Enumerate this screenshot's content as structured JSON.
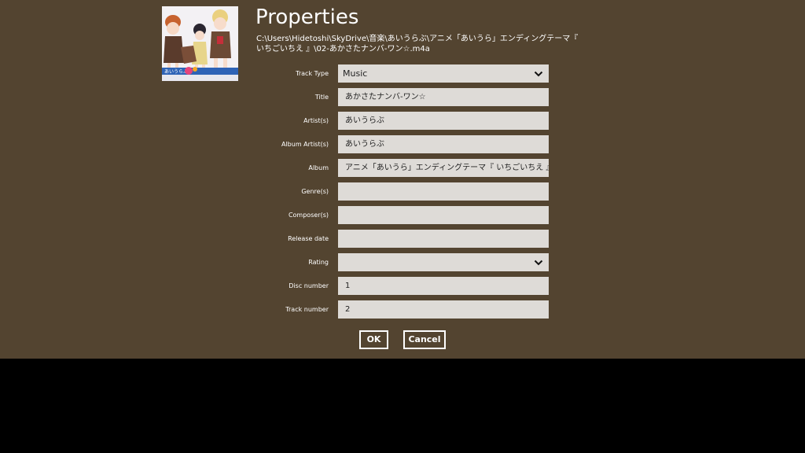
{
  "dialog": {
    "title": "Properties",
    "file_path": "C:\\Users\\Hidetoshi\\SkyDrive\\音楽\\あいうらぶ\\アニメ「あいうら」エンディングテーマ『 いちごいちえ 』\\02-あかさたナンバ-ワン☆.m4a",
    "cover_art_icon": "album-cover-image"
  },
  "fields": {
    "track_type": {
      "label": "Track Type",
      "value": "Music"
    },
    "title": {
      "label": "Title",
      "value": "あかさたナンバ-ワン☆"
    },
    "artists": {
      "label": "Artist(s)",
      "value": "あいうらぶ"
    },
    "album_artists": {
      "label": "Album Artist(s)",
      "value": "あいうらぶ"
    },
    "album": {
      "label": "Album",
      "value": "アニメ「あいうら」エンディングテーマ『 いちごいちえ 』"
    },
    "genres": {
      "label": "Genre(s)",
      "value": ""
    },
    "composers": {
      "label": "Composer(s)",
      "value": ""
    },
    "release_date": {
      "label": "Release date",
      "value": ""
    },
    "rating": {
      "label": "Rating",
      "value": ""
    },
    "disc_number": {
      "label": "Disc number",
      "value": "1"
    },
    "track_number": {
      "label": "Track number",
      "value": "2"
    }
  },
  "buttons": {
    "ok_label": "OK",
    "cancel_label": "Cancel"
  },
  "colors": {
    "dialog_background": "#534430",
    "field_background": "#dedbd7",
    "text": "#ffffff",
    "field_text": "#222222",
    "outside_background": "#000000"
  }
}
